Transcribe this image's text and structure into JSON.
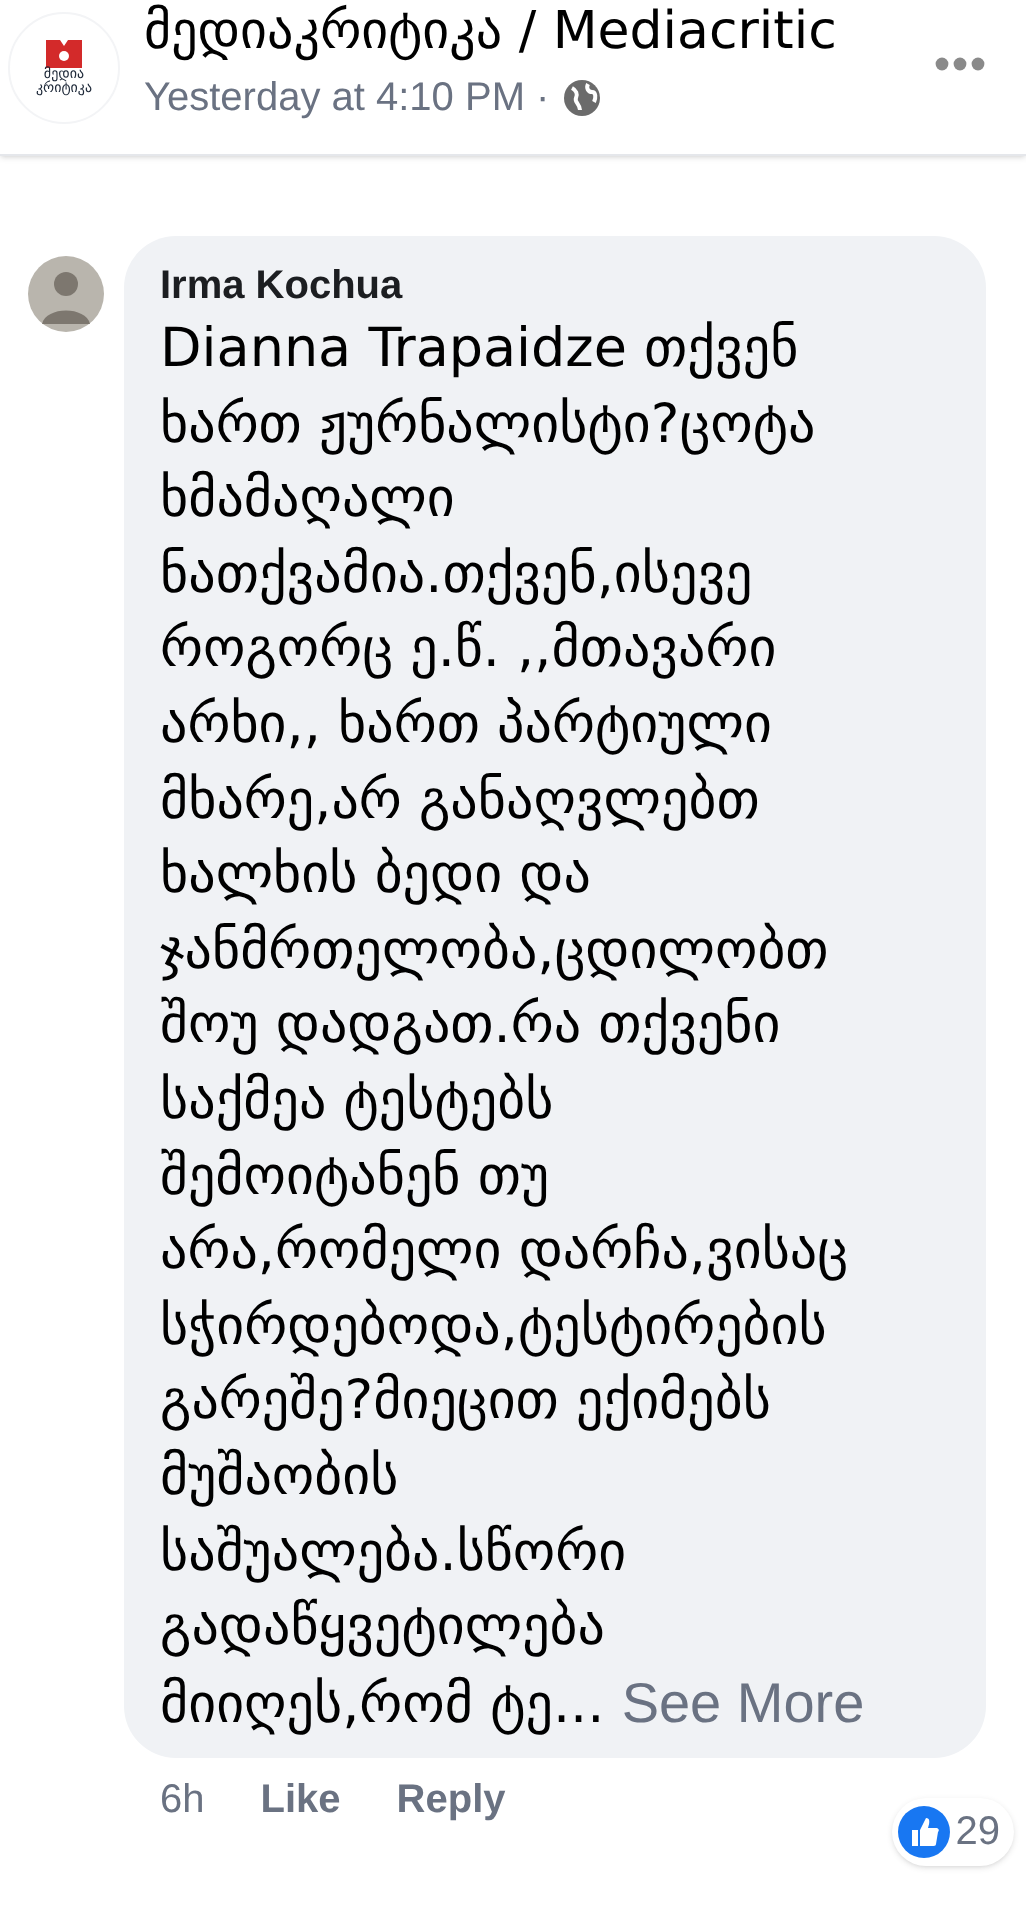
{
  "post": {
    "logo_text": [
      "მედია",
      "კრიტიკა"
    ],
    "page_name": "მედიაკრიტიკა / Mediacritic",
    "time": "Yesterday at 4:10 PM ·"
  },
  "comment": {
    "author": "Irma Kochua",
    "text": "Dianna Trapaidze თქვენ\nხართ ჟურნალისტი?ცოტა\nხმამაღალი\nნათქვამია.თქვენ,ისევე\nროგორც ე.წ. ,,მთავარი\nარხი,, ხართ პარტიული\nმხარე,არ განაღვლებთ\nხალხის ბედი და\nჯანმრთელობა,ცდილობთ\nშოუ დადგათ.რა თქვენი\nსაქმეა ტესტებს\nშემოიტანენ თუ\nარა,რომელი დარჩა,ვისაც\nსჭირდებოდა,ტესტირების\nგარეშე?მიეცით ექიმებს\nმუშაობის\nსაშუალება.სწორი\nგადაწყვეტილება\nმიიღეს,რომ ტე...",
    "see_more": "See More",
    "time": "6h",
    "actions": [
      "Like",
      "Reply"
    ],
    "reaction_count": "29"
  }
}
